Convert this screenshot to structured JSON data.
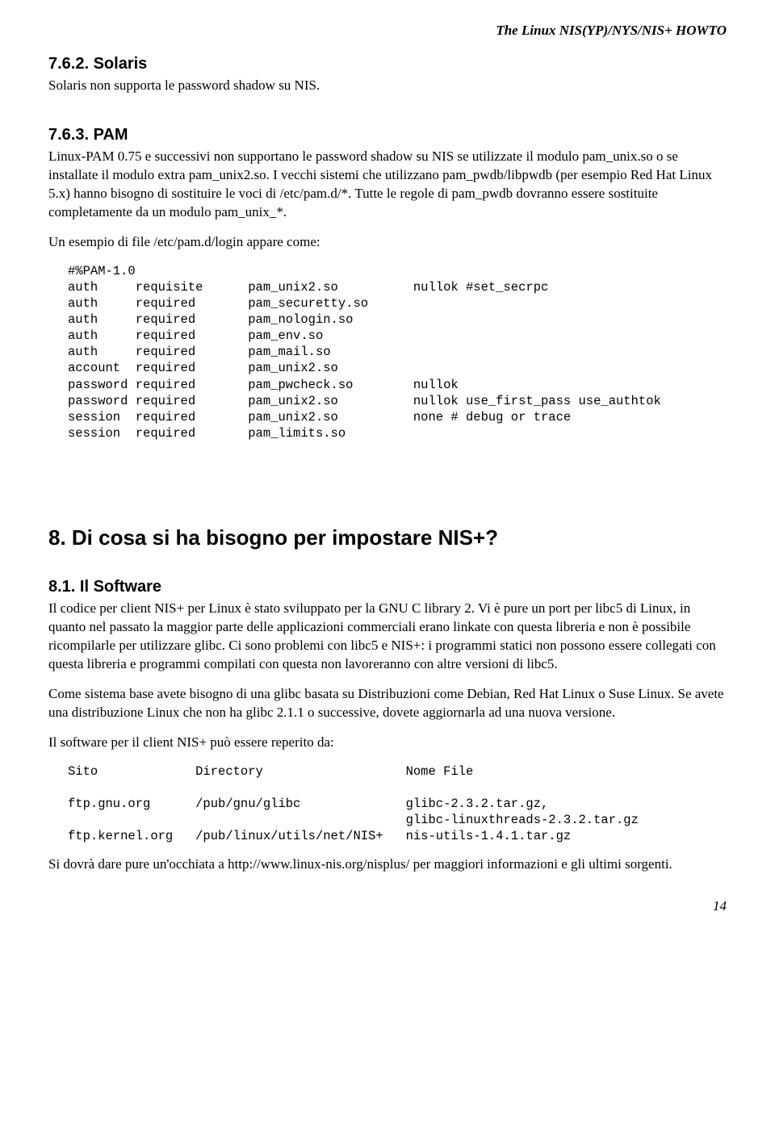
{
  "header": {
    "running_title": "The Linux NIS(YP)/NYS/NIS+ HOWTO"
  },
  "section_762": {
    "heading": "7.6.2. Solaris",
    "body": "Solaris non supporta le password shadow su NIS."
  },
  "section_763": {
    "heading": "7.6.3. PAM",
    "body1": "Linux-PAM 0.75 e successivi non supportano le password shadow su NIS se utilizzate il modulo pam_unix.so o se installate il modulo extra pam_unix2.so. I vecchi sistemi che utilizzano pam_pwdb/libpwdb (per esempio Red Hat Linux 5.x) hanno bisogno di sostituire le voci di /etc/pam.d/*. Tutte le regole di pam_pwdb dovranno essere sostituite completamente da un modulo pam_unix_*.",
    "body2": "Un esempio di file /etc/pam.d/login appare come:",
    "code": "#%PAM-1.0\nauth     requisite      pam_unix2.so          nullok #set_secrpc\nauth     required       pam_securetty.so\nauth     required       pam_nologin.so\nauth     required       pam_env.so\nauth     required       pam_mail.so\naccount  required       pam_unix2.so\npassword required       pam_pwcheck.so        nullok\npassword required       pam_unix2.so          nullok use_first_pass use_authtok\nsession  required       pam_unix2.so          none # debug or trace\nsession  required       pam_limits.so"
  },
  "section_8": {
    "heading": "8. Di cosa si ha bisogno per impostare NIS+?"
  },
  "section_81": {
    "heading": "8.1. Il Software",
    "body1": "Il codice per client NIS+ per Linux è stato sviluppato per la GNU C library 2. Vi è pure un port per libc5 di Linux, in quanto nel passato la maggior parte delle applicazioni commerciali erano linkate con questa libreria e non è possibile ricompilarle per utilizzare glibc. Ci sono problemi con libc5 e NIS+: i programmi statici non possono essere collegati con questa libreria e programmi compilati con questa non lavoreranno con altre versioni di libc5.",
    "body2": "Come sistema base avete bisogno di una glibc basata su Distribuzioni come Debian, Red Hat Linux o Suse Linux. Se avete una distribuzione Linux che non ha glibc 2.1.1 o successive, dovete aggiornarla ad una nuova versione.",
    "body3": "Il software per il client NIS+ può essere reperito da:",
    "code": "Sito             Directory                   Nome File\n\nftp.gnu.org      /pub/gnu/glibc              glibc-2.3.2.tar.gz,\n                                             glibc-linuxthreads-2.3.2.tar.gz\nftp.kernel.org   /pub/linux/utils/net/NIS+   nis-utils-1.4.1.tar.gz",
    "body4": "Si dovrà dare pure un'occhiata a http://www.linux-nis.org/nisplus/ per maggiori informazioni e gli ultimi sorgenti."
  },
  "footer": {
    "page_number": "14"
  }
}
